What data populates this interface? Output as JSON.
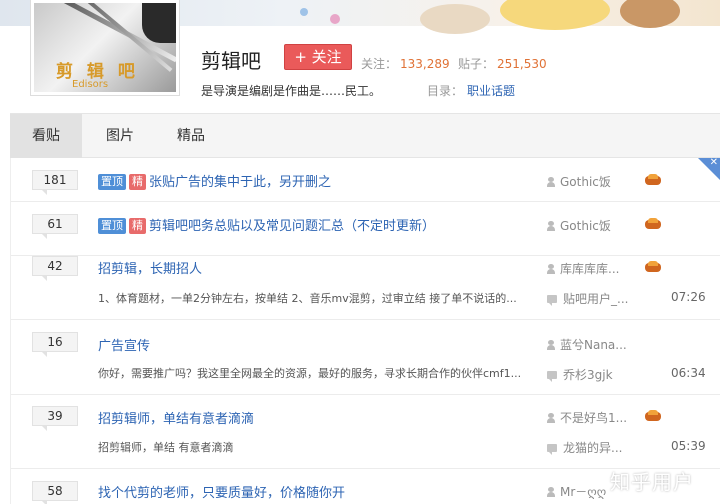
{
  "forum": {
    "name": "剪辑吧",
    "follow_label": "+ 关注",
    "followers_label": "关注：",
    "followers_value": "133,289",
    "posts_label": "贴子：",
    "posts_value": "251,530",
    "slogan": "是导演是编剧是作曲是……民工。",
    "catalog_label": "目录：",
    "catalog_value": "职业话题",
    "avatar_text_main": "剪 辑 吧",
    "avatar_text_sub": "Edisors"
  },
  "tabs": [
    {
      "label": "看贴",
      "active": true
    },
    {
      "label": "图片",
      "active": false
    },
    {
      "label": "精品",
      "active": false
    }
  ],
  "threads": [
    {
      "replies": "181",
      "tags": [
        "置顶",
        "精"
      ],
      "title": "张贴广告的集中于此，另开删之",
      "author": "Gothic饭",
      "abstract": "",
      "last_reply": "",
      "time": ""
    },
    {
      "replies": "61",
      "tags": [
        "置顶",
        "精"
      ],
      "title": "剪辑吧吧务总贴以及常见问题汇总（不定时更新）",
      "author": "Gothic饭",
      "abstract": "",
      "last_reply": "",
      "time": ""
    },
    {
      "replies": "42",
      "tags": [],
      "title": "招剪辑，长期招人",
      "author": "库库库库...",
      "abstract": "1、体育题材，一单2分钟左右，按单结 2、音乐mv混剪，过审立结 接了单不说话的...",
      "last_reply": "贴吧用户_...",
      "time": "07:26"
    },
    {
      "replies": "16",
      "tags": [],
      "title": "广告宣传",
      "author": "蓝兮Nana...",
      "abstract": "你好，需要推广吗？我这里全网最全的资源，最好的服务，寻求长期合作的伙伴cmf1...",
      "last_reply": "乔杉3gjk",
      "time": "06:34"
    },
    {
      "replies": "39",
      "tags": [],
      "title": "招剪辑师，单结有意者滴滴",
      "author": "不是好鸟1...",
      "abstract": "招剪辑师，单结 有意者滴滴",
      "last_reply": "龙猫的异...",
      "time": "05:39"
    },
    {
      "replies": "58",
      "tags": [],
      "title": "找个代剪的老师，只要质量好，价格随你开",
      "author": "Mr－ღღ",
      "abstract": "",
      "last_reply": "",
      "time": ""
    }
  ],
  "corner_label": "✕",
  "watermark": "知乎用户"
}
